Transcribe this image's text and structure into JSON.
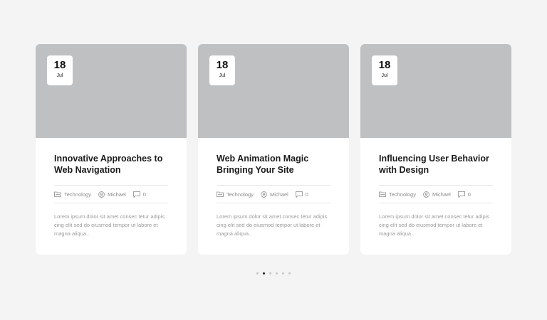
{
  "posts": [
    {
      "day": "18",
      "month": "Jul",
      "title": "Innovative Approaches to Web Navigation",
      "category": "Technology",
      "author": "Michael",
      "comments": "0",
      "excerpt": "Lorem ipsum dolor sit amet consec tetur adipis cing elit sed do eiusmod tempor ut labore et magna aliqua.."
    },
    {
      "day": "18",
      "month": "Jul",
      "title": "Web Animation Magic Bringing Your Site",
      "category": "Technology",
      "author": "Michael",
      "comments": "0",
      "excerpt": "Lorem ipsum dolor sit amet consec tetur adipis cing elit sed do eiusmod tempor ut labore et magna aliqua.."
    },
    {
      "day": "18",
      "month": "Jul",
      "title": "Influencing User Behavior with Design",
      "category": "Technology",
      "author": "Michael",
      "comments": "0",
      "excerpt": "Lorem ipsum dolor sit amet consec tetur adipis cing elit sed do eiusmod tempor ut labore et magna aliqua.."
    }
  ],
  "pagination": {
    "total": 6,
    "active": 2
  },
  "icons": {
    "category": "folder-icon",
    "author": "user-icon",
    "comments": "comment-icon"
  },
  "colors": {
    "image_placeholder": "#bfc0c2",
    "active_dot": "#222222",
    "inactive_dot": "#c6c6c6"
  }
}
